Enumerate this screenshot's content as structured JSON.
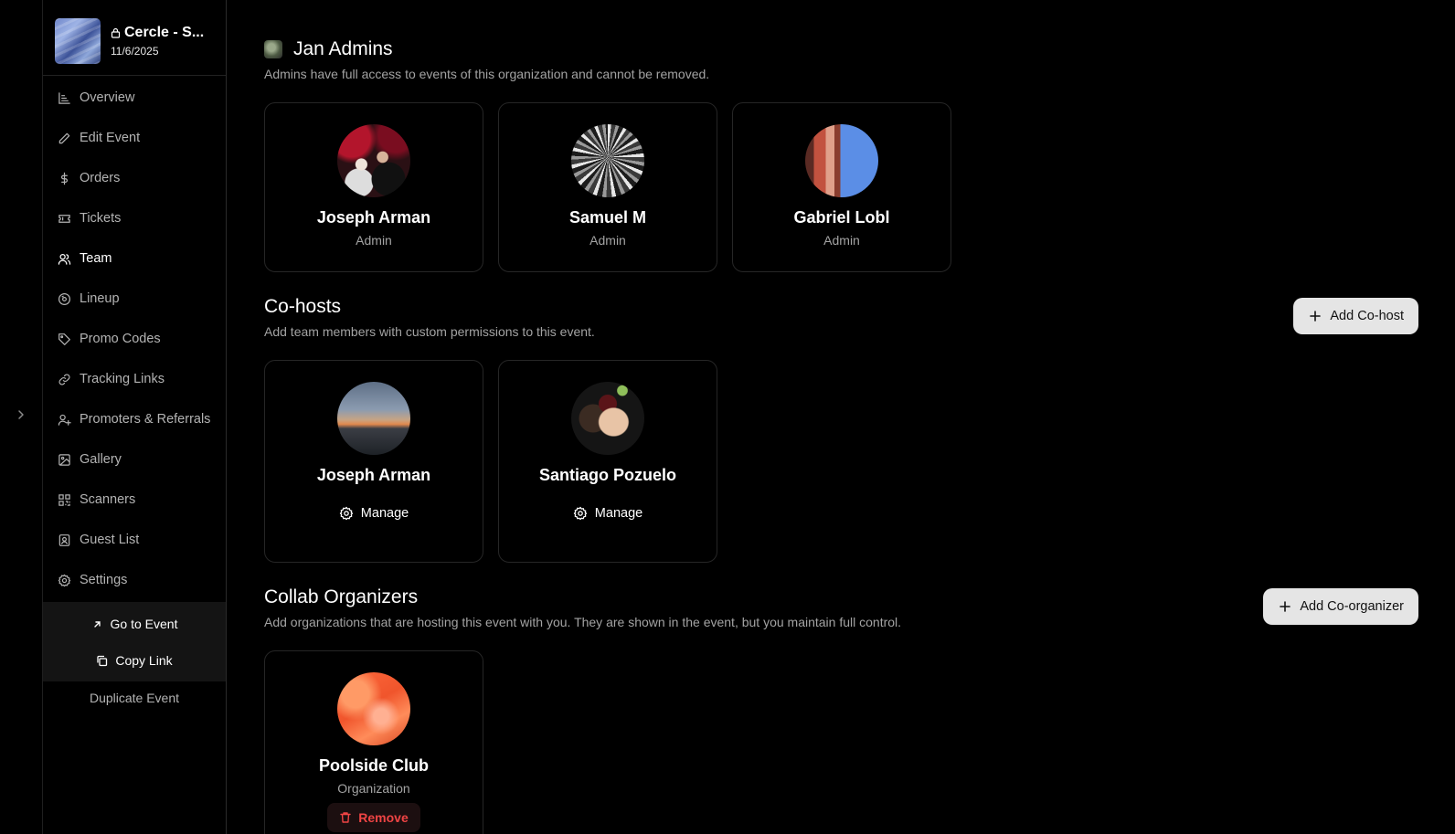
{
  "event": {
    "title": "Cercle - S...",
    "date": "11/6/2025"
  },
  "sidebar": {
    "items": [
      {
        "label": "Overview",
        "icon": "chart-icon"
      },
      {
        "label": "Edit Event",
        "icon": "pencil-icon"
      },
      {
        "label": "Orders",
        "icon": "dollar-icon"
      },
      {
        "label": "Tickets",
        "icon": "ticket-icon"
      },
      {
        "label": "Team",
        "icon": "users-icon",
        "active": true
      },
      {
        "label": "Lineup",
        "icon": "disc-icon"
      },
      {
        "label": "Promo Codes",
        "icon": "tag-icon"
      },
      {
        "label": "Tracking Links",
        "icon": "link-icon"
      },
      {
        "label": "Promoters & Referrals",
        "icon": "user-plus-icon"
      },
      {
        "label": "Gallery",
        "icon": "image-icon"
      },
      {
        "label": "Scanners",
        "icon": "qr-icon"
      },
      {
        "label": "Guest List",
        "icon": "contact-icon"
      },
      {
        "label": "Settings",
        "icon": "gear-icon"
      }
    ],
    "go_to_event": "Go to Event",
    "copy_link": "Copy Link",
    "duplicate_event": "Duplicate Event"
  },
  "admins": {
    "title": "Jan Admins",
    "description": "Admins have full access to events of this organization and cannot be removed.",
    "members": [
      {
        "name": "Joseph Arman",
        "role": "Admin"
      },
      {
        "name": "Samuel M",
        "role": "Admin"
      },
      {
        "name": "Gabriel Lobl",
        "role": "Admin"
      }
    ]
  },
  "cohosts": {
    "title": "Co-hosts",
    "description": "Add team members with custom permissions to this event.",
    "add_label": "Add Co-host",
    "manage_label": "Manage",
    "members": [
      {
        "name": "Joseph Arman"
      },
      {
        "name": "Santiago Pozuelo"
      }
    ]
  },
  "collab": {
    "title": "Collab Organizers",
    "description": "Add organizations that are hosting this event with you. They are shown in the event, but you maintain full control.",
    "add_label": "Add Co-organizer",
    "remove_label": "Remove",
    "organizations": [
      {
        "name": "Poolside Club",
        "role": "Organization"
      }
    ]
  },
  "colors": {
    "background": "#000000",
    "remove": "#ef4444",
    "button_bg": "#e5e5e5"
  }
}
